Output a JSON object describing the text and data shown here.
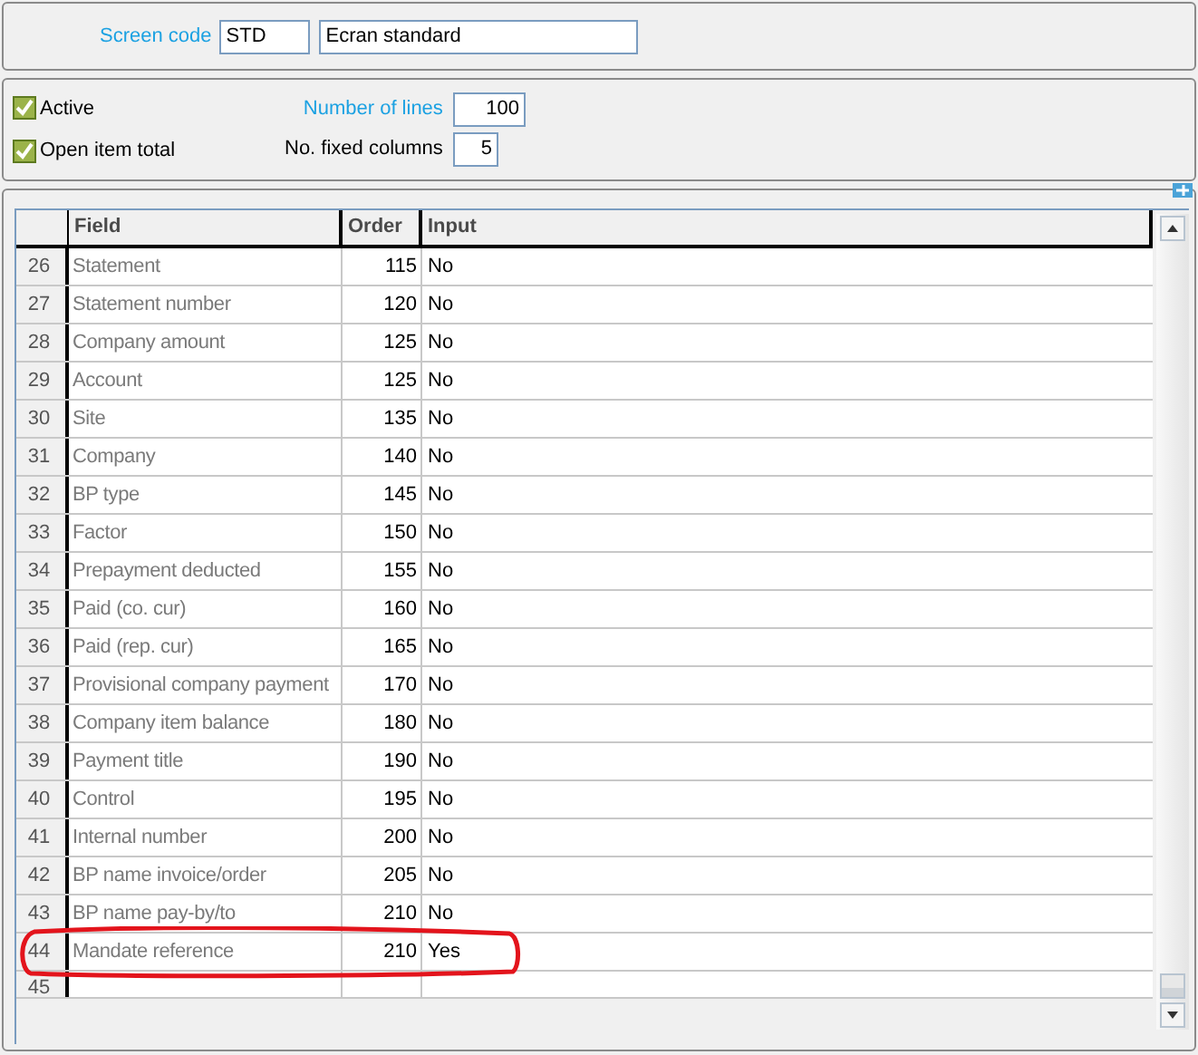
{
  "header": {
    "screen_code_label": "Screen code",
    "screen_code": "STD",
    "description": "Ecran standard"
  },
  "options": {
    "checkboxes": [
      {
        "label": "Active",
        "checked": true
      },
      {
        "label": "Open item total",
        "checked": true
      }
    ],
    "number_of_lines_label": "Number of lines",
    "number_of_lines": "100",
    "fixed_columns_label": "No. fixed columns",
    "fixed_columns": "5"
  },
  "table": {
    "columns": [
      "Field",
      "Order",
      "Input"
    ],
    "rows": [
      {
        "num": "26",
        "field": "Statement",
        "order": "115",
        "input": "No",
        "circled": false
      },
      {
        "num": "27",
        "field": "Statement number",
        "order": "120",
        "input": "No",
        "circled": false
      },
      {
        "num": "28",
        "field": "Company amount",
        "order": "125",
        "input": "No",
        "circled": false
      },
      {
        "num": "29",
        "field": "Account",
        "order": "125",
        "input": "No",
        "circled": false
      },
      {
        "num": "30",
        "field": "Site",
        "order": "135",
        "input": "No",
        "circled": false
      },
      {
        "num": "31",
        "field": "Company",
        "order": "140",
        "input": "No",
        "circled": false
      },
      {
        "num": "32",
        "field": "BP type",
        "order": "145",
        "input": "No",
        "circled": false
      },
      {
        "num": "33",
        "field": "Factor",
        "order": "150",
        "input": "No",
        "circled": false
      },
      {
        "num": "34",
        "field": "Prepayment deducted",
        "order": "155",
        "input": "No",
        "circled": false
      },
      {
        "num": "35",
        "field": "Paid (co. cur)",
        "order": "160",
        "input": "No",
        "circled": false
      },
      {
        "num": "36",
        "field": "Paid (rep. cur)",
        "order": "165",
        "input": "No",
        "circled": false
      },
      {
        "num": "37",
        "field": "Provisional company payment",
        "order": "170",
        "input": "No",
        "circled": false
      },
      {
        "num": "38",
        "field": "Company item balance",
        "order": "180",
        "input": "No",
        "circled": false
      },
      {
        "num": "39",
        "field": "Payment title",
        "order": "190",
        "input": "No",
        "circled": false
      },
      {
        "num": "40",
        "field": "Control",
        "order": "195",
        "input": "No",
        "circled": false
      },
      {
        "num": "41",
        "field": "Internal number",
        "order": "200",
        "input": "No",
        "circled": false
      },
      {
        "num": "42",
        "field": "BP name invoice/order",
        "order": "205",
        "input": "No",
        "circled": false
      },
      {
        "num": "43",
        "field": "BP name pay-by/to",
        "order": "210",
        "input": "No",
        "circled": false
      },
      {
        "num": "44",
        "field": "Mandate reference",
        "order": "210",
        "input": "Yes",
        "circled": true
      },
      {
        "num": "45",
        "circled": false
      }
    ]
  }
}
